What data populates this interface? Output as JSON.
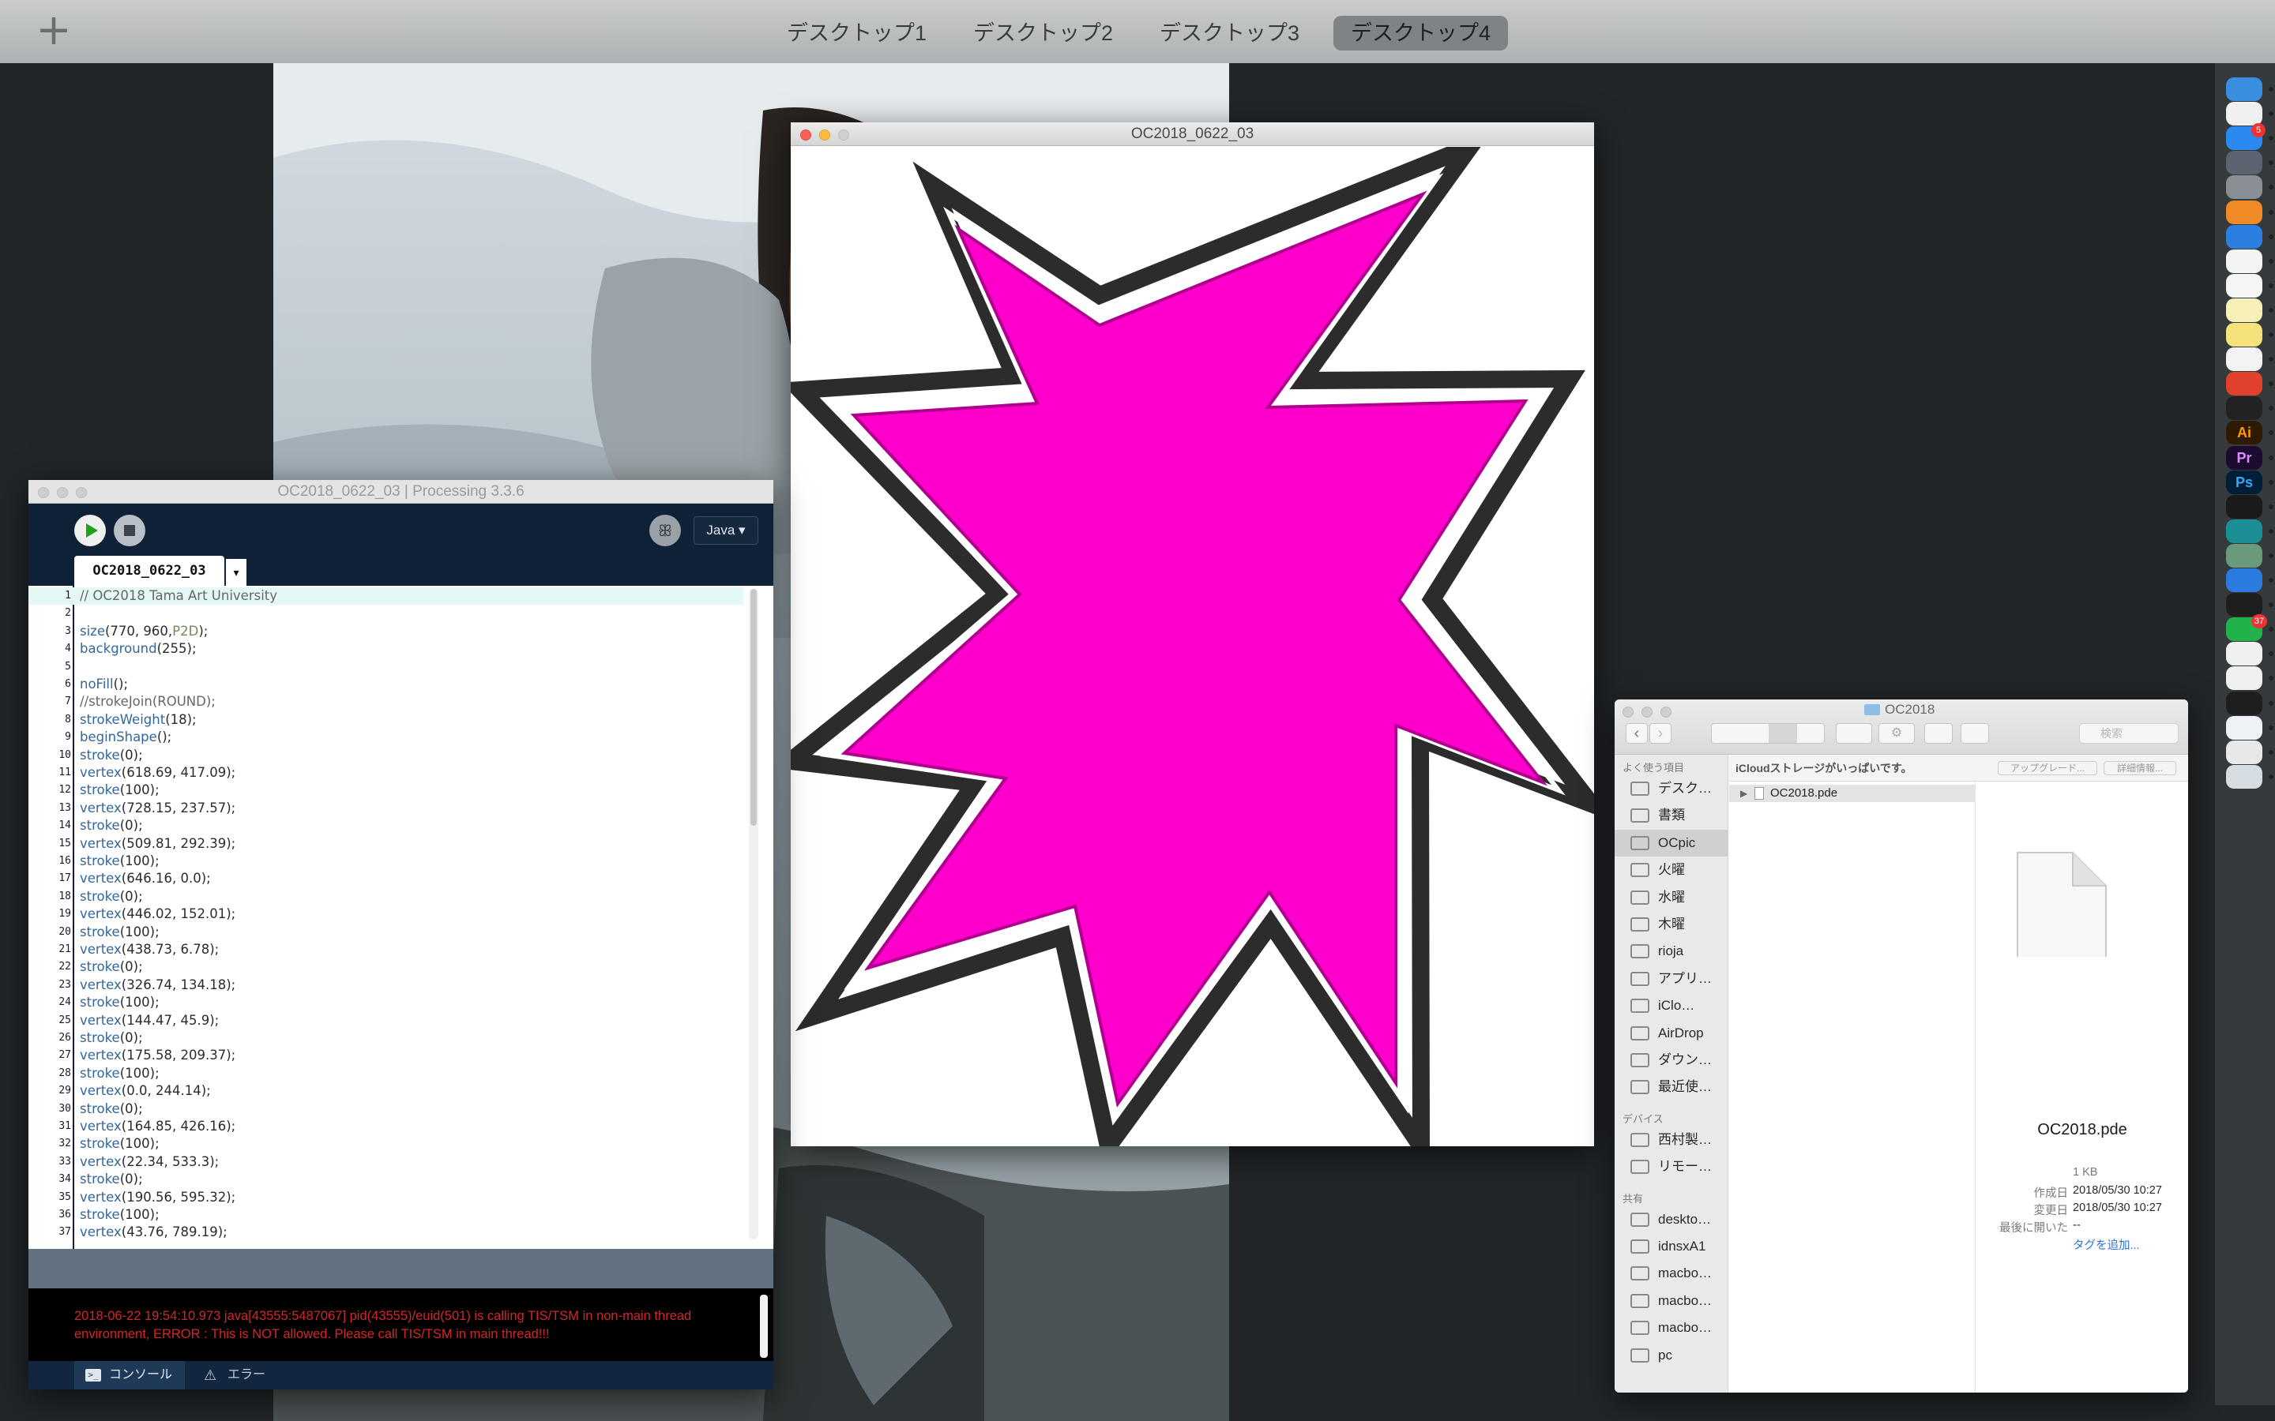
{
  "mission_control": {
    "add_label": "+",
    "desktops": [
      "デスクトップ1",
      "デスクトップ2",
      "デスクトップ3",
      "デスクトップ4"
    ],
    "active_desktop": "デスクトップ4"
  },
  "sketch_window": {
    "title": "OC2018_0622_03",
    "shape_fill": "#ff00cc"
  },
  "ide": {
    "title": "OC2018_0622_03 | Processing 3.3.6",
    "mode": "Java ▾",
    "tab_label": "OC2018_0622_03",
    "tab_menu": "▾",
    "code_lines": [
      "// OC2018 Tama Art University",
      "",
      "size(770, 960,P2D);",
      "background(255);",
      "",
      "noFill();",
      "//strokeJoin(ROUND);",
      "strokeWeight(18);",
      "beginShape();",
      "stroke(0);",
      "vertex(618.69, 417.09);",
      "stroke(100);",
      "vertex(728.15, 237.57);",
      "stroke(0);",
      "vertex(509.81, 292.39);",
      "stroke(100);",
      "vertex(646.16, 0.0);",
      "stroke(0);",
      "vertex(446.02, 152.01);",
      "stroke(100);",
      "vertex(438.73, 6.78);",
      "stroke(0);",
      "vertex(326.74, 134.18);",
      "stroke(100);",
      "vertex(144.47, 45.9);",
      "stroke(0);",
      "vertex(175.58, 209.37);",
      "stroke(100);",
      "vertex(0.0, 244.14);",
      "stroke(0);",
      "vertex(164.85, 426.16);",
      "stroke(100);",
      "vertex(22.34, 533.3);",
      "stroke(0);",
      "vertex(190.56, 595.32);",
      "stroke(100);",
      "vertex(43.76, 789.19);"
    ],
    "console_text": "2018-06-22 19:54:10.973 java[43555:5487067] pid(43555)/euid(501) is calling TIS/TSM in non-main thread environment, ERROR : This is NOT allowed. Please call TIS/TSM in main thread!!!",
    "console_tab": "コンソール",
    "error_tab": "エラー"
  },
  "finder": {
    "title": "OC2018",
    "search_placeholder": "検索",
    "icloud_notice": "iCloudストレージがいっぱいです。",
    "upgrade_button": "アップグレード...",
    "details_button": "詳細情報...",
    "sidebar_favorites_header": "よく使う項目",
    "favorites": [
      "デスク…",
      "書類",
      "OCpic",
      "火曜",
      "水曜",
      "木曜",
      "rioja",
      "アプリ…",
      "iClo…",
      "AirDrop",
      "ダウン…",
      "最近使…"
    ],
    "selected_favorite": "OCpic",
    "sidebar_devices_header": "デバイス",
    "devices": [
      "西村製…",
      "リモー…"
    ],
    "sidebar_shared_header": "共有",
    "shared": [
      "deskto…",
      "idnsxA1",
      "macbo…",
      "macbo…",
      "macbo…",
      "pc"
    ],
    "file_name": "OC2018.pde",
    "preview_name": "OC2018.pde",
    "size": "1 KB",
    "created_label": "作成日",
    "created": "2018/05/30 10:27",
    "modified_label": "変更日",
    "modified": "2018/05/30 10:27",
    "last_opened_label": "最後に開いた",
    "last_opened": "--",
    "add_tags": "タグを追加..."
  },
  "dock": {
    "apps": [
      "Finder",
      "iTunes",
      "App Store",
      "Launchpad",
      "System Preferences",
      "iBooks",
      "Safari",
      "Chrome",
      "Photos",
      "Notes",
      "Stickies",
      "TextEdit",
      "Git",
      "Unity",
      "Ai",
      "Pr",
      "Ps",
      "Processing",
      "Arduino",
      "Atom",
      "Xcode",
      "Terminal",
      "LINE",
      "Script Editor",
      "Numbers",
      "QuickTime",
      "Preview",
      "Browser",
      "Trash"
    ],
    "app_store_badge": "5",
    "line_badge": "37",
    "ai_label": "Ai",
    "pr_label": "Pr",
    "ps_label": "Ps"
  }
}
